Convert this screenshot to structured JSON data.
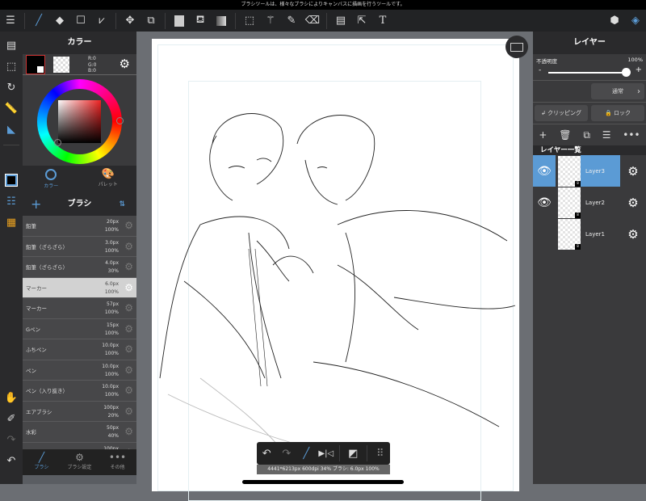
{
  "status_bar": {
    "hint": "ブラシツールは、様々なブラシによりキャンバスに描画を行うツールです。"
  },
  "color_panel": {
    "title": "カラー",
    "r": "R:0",
    "g": "G:0",
    "b": "B:0",
    "tabs": [
      {
        "label": "カラー"
      },
      {
        "label": "パレット"
      }
    ],
    "main_color": "#000000"
  },
  "brush_panel": {
    "title": "ブラシ",
    "brushes": [
      {
        "name": "鉛筆",
        "size": "20px",
        "opacity": "100%"
      },
      {
        "name": "鉛筆（ざらざら）",
        "size": "3.0px",
        "opacity": "100%"
      },
      {
        "name": "鉛筆（ざらざら）",
        "size": "4.0px",
        "opacity": "30%"
      },
      {
        "name": "マーカー",
        "size": "6.0px",
        "opacity": "100%",
        "selected": true
      },
      {
        "name": "マーカー",
        "size": "57px",
        "opacity": "100%"
      },
      {
        "name": "Gペン",
        "size": "15px",
        "opacity": "100%"
      },
      {
        "name": "ふちペン",
        "size": "10.0px",
        "opacity": "100%"
      },
      {
        "name": "ペン",
        "size": "10.0px",
        "opacity": "100%"
      },
      {
        "name": "ペン（入り抜き）",
        "size": "10.0px",
        "opacity": "100%"
      },
      {
        "name": "エアブラシ",
        "size": "100px",
        "opacity": "20%"
      },
      {
        "name": "水彩",
        "size": "50px",
        "opacity": "40%"
      },
      {
        "name": "",
        "size": "100px",
        "opacity": ""
      }
    ],
    "bottom_tabs": [
      {
        "label": "ブラシ"
      },
      {
        "label": "ブラシ設定"
      },
      {
        "label": "その他"
      }
    ]
  },
  "layer_panel": {
    "title": "レイヤー",
    "opacity_label": "不透明度",
    "opacity_value": "100%",
    "opacity_fraction": 1.0,
    "blend_mode": "通常",
    "clipping": "クリッピング",
    "lock": "ロック",
    "list_title": "レイヤー一覧",
    "layers": [
      {
        "name": "Layer3",
        "visible": true,
        "selected": true
      },
      {
        "name": "Layer2",
        "visible": true
      },
      {
        "name": "Layer1",
        "visible": false
      }
    ]
  },
  "canvas_info": "4441*6213px 600dpi 34% ブラシ: 6.0px 100%",
  "accent": "#5b9bd5"
}
